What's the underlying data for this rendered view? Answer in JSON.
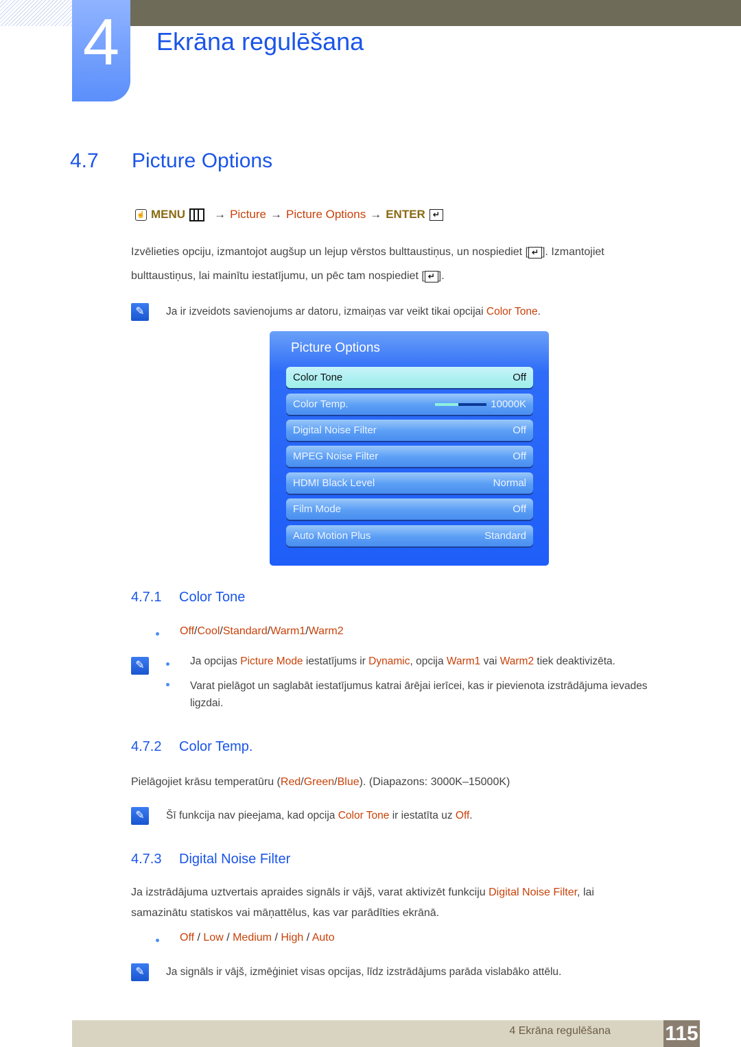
{
  "chapter": {
    "number": "4",
    "title": "Ekrāna regulēšana"
  },
  "section": {
    "number": "4.7",
    "title": "Picture Options"
  },
  "menu_path": {
    "menu": "MENU",
    "arrow": "→",
    "step1": "Picture",
    "step2": "Picture Options",
    "enter": "ENTER"
  },
  "intro": {
    "line1_a": "Izvēlieties opciju, izmantojot augšup un lejup vērstos bulttaustiņus, un nospiediet [",
    "line1_b": "]. Izmantojiet",
    "line2_a": "bulttaustiņus, lai mainītu iestatījumu, un pēc tam nospiediet [",
    "line2_b": "]."
  },
  "note1": {
    "text": "Ja ir izveidots savienojums ar datoru, izmaiņas var veikt tikai opcijai ",
    "hl": "Color Tone",
    "end": "."
  },
  "osd": {
    "title": "Picture Options",
    "rows": [
      {
        "label": "Color Tone",
        "value": "Off",
        "selected": true
      },
      {
        "label": "Color Temp.",
        "value": "10000K",
        "slider_fraction": 0.45
      },
      {
        "label": "Digital Noise Filter",
        "value": "Off"
      },
      {
        "label": "MPEG Noise Filter",
        "value": "Off"
      },
      {
        "label": "HDMI Black Level",
        "value": "Normal"
      },
      {
        "label": "Film Mode",
        "value": "Off"
      },
      {
        "label": "Auto Motion Plus",
        "value": "Standard"
      }
    ]
  },
  "s1": {
    "number": "4.7.1",
    "title": "Color Tone",
    "options": [
      "Off",
      "Cool",
      "Standard",
      "Warm1",
      "Warm2"
    ],
    "note_b1": {
      "t1": "Ja opcijas ",
      "h1": "Picture Mode",
      "t2": " iestatījums ir ",
      "h2": "Dynamic",
      "t3": ", opcija ",
      "h3": "Warm1",
      "t4": " vai ",
      "h4": "Warm2",
      "t5": " tiek deaktivizēta."
    },
    "note_b2": "Varat pielāgot un saglabāt iestatījumus katrai ārējai ierīcei, kas ir pievienota izstrādājuma ievades ligzdai."
  },
  "s2": {
    "number": "4.7.2",
    "title": "Color Temp.",
    "p": {
      "t1": "Pielāgojiet krāsu temperatūru (",
      "h1": "Red",
      "h2": "Green",
      "h3": "Blue",
      "t2": "). (Diapazons: 3000K–15000K)"
    },
    "note": {
      "t1": "Šī funkcija nav pieejama, kad opcija ",
      "h1": "Color Tone",
      "t2": " ir iestatīta uz ",
      "h2": "Off",
      "t3": "."
    }
  },
  "s3": {
    "number": "4.7.3",
    "title": "Digital Noise Filter",
    "p1_a": "Ja izstrādājuma uztvertais apraides signāls ir vājš, varat aktivizēt funkciju ",
    "p1_h": "Digital Noise Filter",
    "p1_b": ", lai",
    "p2": "samazinātu statiskos vai māņattēlus, kas var parādīties ekrānā.",
    "options": [
      "Off",
      "Low",
      "Medium",
      "High",
      "Auto"
    ],
    "note": "Ja signāls ir vājš, izmēģiniet visas opcijas, līdz izstrādājums parāda vislabāko attēlu."
  },
  "footer": {
    "chapter": "4 Ekrāna regulēšana",
    "page": "115"
  }
}
